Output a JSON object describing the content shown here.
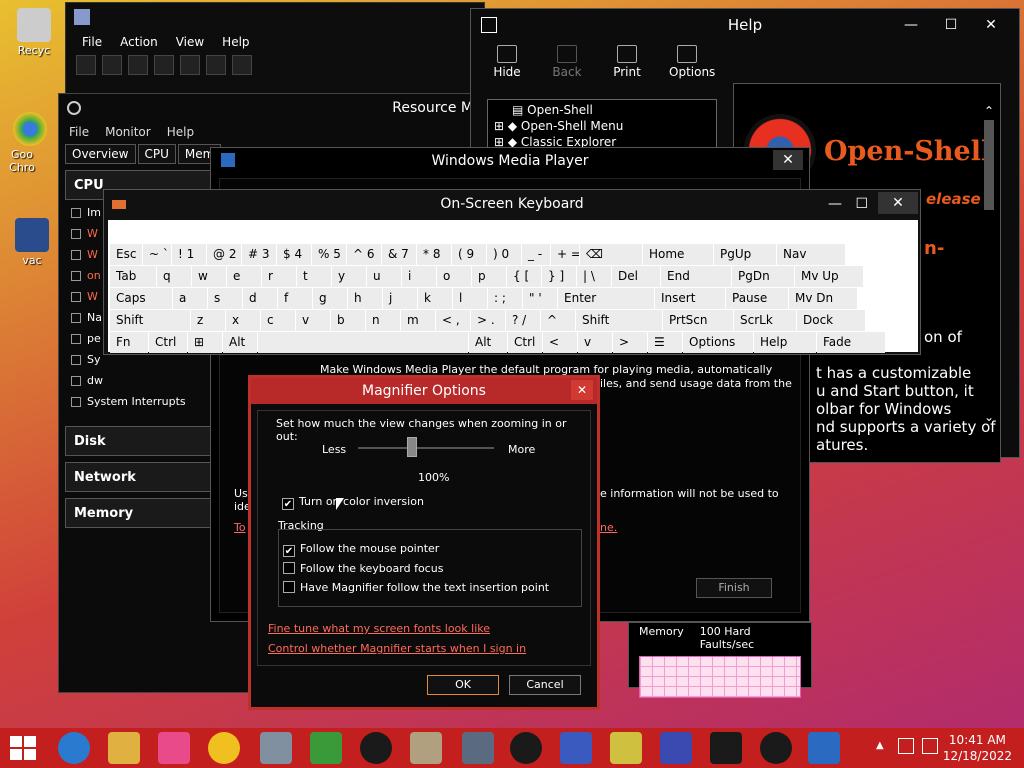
{
  "desktop": {
    "icons": [
      {
        "label": "Recyc"
      },
      {
        "label": "Goo Chro"
      },
      {
        "label": "vac"
      }
    ]
  },
  "mmc": {
    "menu": [
      "File",
      "Action",
      "View",
      "Help"
    ]
  },
  "resmon": {
    "title": "Resource M",
    "menu": [
      "File",
      "Monitor",
      "Help"
    ],
    "tabs": [
      "Overview",
      "CPU",
      "Mem"
    ],
    "sections": [
      "CPU",
      "Disk",
      "Network",
      "Memory"
    ],
    "processes": [
      "Im",
      "W",
      "W",
      "on",
      "W",
      "Na",
      "pe",
      "Sy",
      "dw",
      "System Interrupts"
    ]
  },
  "help": {
    "title": "Help",
    "tools": [
      "Hide",
      "Back",
      "Print",
      "Options"
    ],
    "tree": [
      "Open-Shell",
      "Open-Shell Menu",
      "Classic Explorer"
    ],
    "brand": "Open-Shell",
    "release_fragment": "elease",
    "dash_fragment": "n-",
    "text_lines": [
      "on of",
      "t has a customizable",
      "u and Start button, it",
      "olbar for Windows",
      "nd supports a variety of",
      "atures."
    ]
  },
  "wmp": {
    "title": "Windows Media Player",
    "line1": "Make Windows Media Player the default program for playing media, automatically download",
    "line2": "iles, and send usage data from the",
    "usage_left": "Usa",
    "ide_left": "ide",
    "usage_right": "e information will not be used to",
    "link_left": "To",
    "link_right": "ne.",
    "finish": "Finish"
  },
  "osk": {
    "title": "On-Screen Keyboard",
    "rows": [
      [
        "Esc",
        "~ `",
        "! 1",
        "@ 2",
        "# 3",
        "$ 4",
        "% 5",
        "^ 6",
        "& 7",
        "* 8",
        "( 9",
        ") 0",
        "_ -",
        "+ =",
        "⌫",
        "Home",
        "PgUp",
        "Nav"
      ],
      [
        "Tab",
        "q",
        "w",
        "e",
        "r",
        "t",
        "y",
        "u",
        "i",
        "o",
        "p",
        "{ [",
        "} ]",
        "| \\",
        "Del",
        "End",
        "PgDn",
        "Mv Up"
      ],
      [
        "Caps",
        "a",
        "s",
        "d",
        "f",
        "g",
        "h",
        "j",
        "k",
        "l",
        ": ;",
        "\" '",
        "Enter",
        "Insert",
        "Pause",
        "Mv Dn"
      ],
      [
        "Shift",
        "z",
        "x",
        "c",
        "v",
        "b",
        "n",
        "m",
        "< ,",
        "> .",
        "? /",
        "^",
        "Shift",
        "PrtScn",
        "ScrLk",
        "Dock"
      ],
      [
        "Fn",
        "Ctrl",
        "⊞",
        "Alt",
        "",
        "Alt",
        "Ctrl",
        "<",
        "v",
        ">",
        "☰",
        "Options",
        "Help",
        "Fade"
      ]
    ]
  },
  "magnifier": {
    "title": "Magnifier Options",
    "zoom_prompt": "Set how much the view changes when zooming in or out:",
    "less": "Less",
    "more": "More",
    "zoom_value": "100%",
    "zoom_fraction": 0.4,
    "color_inversion": "Turn on color inversion",
    "tracking_label": "Tracking",
    "follow_mouse": "Follow the mouse pointer",
    "follow_keyboard": "Follow the keyboard focus",
    "follow_text": "Have Magnifier follow the text insertion point",
    "link_fonts": "Fine tune what my screen fonts look like",
    "link_signin": "Control whether Magnifier starts when I sign in",
    "ok": "OK",
    "cancel": "Cancel",
    "checked": {
      "inversion": "✔",
      "mouse": "✔",
      "keyboard": "",
      "text": ""
    }
  },
  "memory_graph": {
    "label": "Memory",
    "value": "100 Hard Faults/sec"
  },
  "taskbar": {
    "time": "10:41 AM",
    "date": "12/18/2022"
  },
  "colors": {
    "accent_red": "#c41f1f",
    "brand_orange": "#e85a1e",
    "link_red": "#ff6a5a"
  }
}
